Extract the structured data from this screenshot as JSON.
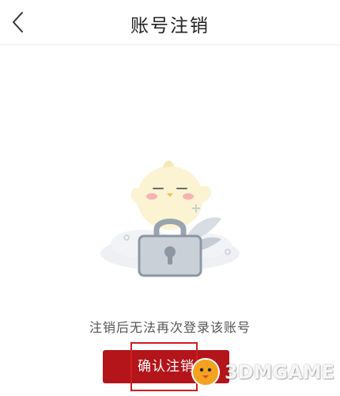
{
  "header": {
    "back_icon": "chevron-left-icon",
    "title": "账号注销"
  },
  "main": {
    "illustration": "chick-on-lock-illustration",
    "message": "注销后无法再次登录该账号",
    "confirm_label": "确认注销"
  },
  "watermark": {
    "logo": "3dmgame-chick-logo",
    "text": "3DMGAME"
  },
  "colors": {
    "accent": "#b3151b",
    "highlight": "#d21c1c",
    "lock": "#c9d0d8"
  }
}
